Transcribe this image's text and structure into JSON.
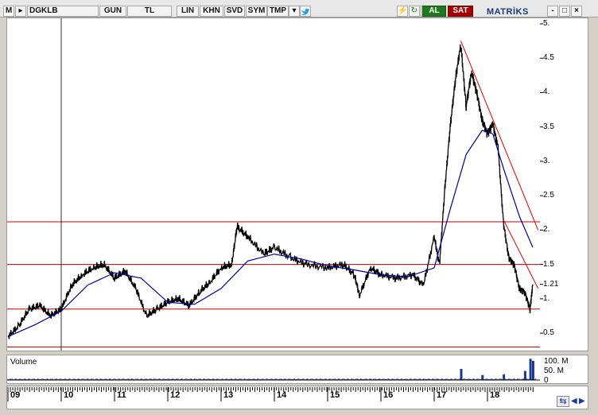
{
  "toolbar": {
    "window_icon": "M",
    "symbol": "DGKLB",
    "period": "GUN",
    "currency": "TL",
    "scale_lin": "LIN",
    "khn": "KHN",
    "svd": "SVD",
    "sym": "SYM",
    "tmp": "TMP",
    "buy": "AL",
    "sell": "SAT",
    "brand": "MATRİKS",
    "minimize": "-",
    "restore": "□",
    "close": "×",
    "icons": [
      "dropdown-arrow-icon",
      "twitter-bird-icon",
      "lightning-icon",
      "refresh-icon",
      "settings-icon"
    ]
  },
  "colors": {
    "candles": "#000000",
    "moving_average": "#0000a0",
    "horizontal_levels": "#c00000",
    "trend_lines": "#e00000",
    "volume": "#1a3a8a",
    "buy_bg": "#1f7a1f",
    "sell_bg": "#a80000",
    "brand": "#1a3a7a"
  },
  "chart_data": {
    "type": "line",
    "x_ticks": [
      "09",
      "10",
      "11",
      "12",
      "13",
      "14",
      "15",
      "16",
      "17",
      "18"
    ],
    "y_ticks": [
      "5.",
      "4.5",
      "4.",
      "3.5",
      "3.",
      "2.5",
      "2.",
      "1.5",
      "1.21",
      "1.",
      "0.5"
    ],
    "ylim": [
      0.2,
      5.0
    ],
    "last_price": "1.21",
    "horizontal_levels": [
      0.3,
      0.85,
      1.5,
      2.12
    ],
    "vertical_marker_year": "10",
    "price_series": [
      {
        "x": 2009.0,
        "y": 0.45
      },
      {
        "x": 2009.2,
        "y": 0.6
      },
      {
        "x": 2009.4,
        "y": 0.85
      },
      {
        "x": 2009.6,
        "y": 0.9
      },
      {
        "x": 2009.8,
        "y": 0.75
      },
      {
        "x": 2010.0,
        "y": 0.85
      },
      {
        "x": 2010.2,
        "y": 1.2
      },
      {
        "x": 2010.4,
        "y": 1.35
      },
      {
        "x": 2010.6,
        "y": 1.45
      },
      {
        "x": 2010.8,
        "y": 1.5
      },
      {
        "x": 2011.0,
        "y": 1.3
      },
      {
        "x": 2011.2,
        "y": 1.4
      },
      {
        "x": 2011.4,
        "y": 1.15
      },
      {
        "x": 2011.6,
        "y": 0.75
      },
      {
        "x": 2011.8,
        "y": 0.85
      },
      {
        "x": 2012.0,
        "y": 0.95
      },
      {
        "x": 2012.2,
        "y": 1.0
      },
      {
        "x": 2012.4,
        "y": 0.9
      },
      {
        "x": 2012.6,
        "y": 1.1
      },
      {
        "x": 2012.8,
        "y": 1.25
      },
      {
        "x": 2013.0,
        "y": 1.45
      },
      {
        "x": 2013.2,
        "y": 1.5
      },
      {
        "x": 2013.3,
        "y": 2.05
      },
      {
        "x": 2013.5,
        "y": 1.9
      },
      {
        "x": 2013.8,
        "y": 1.65
      },
      {
        "x": 2014.0,
        "y": 1.75
      },
      {
        "x": 2014.3,
        "y": 1.6
      },
      {
        "x": 2014.6,
        "y": 1.5
      },
      {
        "x": 2015.0,
        "y": 1.45
      },
      {
        "x": 2015.3,
        "y": 1.5
      },
      {
        "x": 2015.5,
        "y": 1.35
      },
      {
        "x": 2015.6,
        "y": 1.05
      },
      {
        "x": 2015.8,
        "y": 1.45
      },
      {
        "x": 2016.0,
        "y": 1.35
      },
      {
        "x": 2016.3,
        "y": 1.3
      },
      {
        "x": 2016.6,
        "y": 1.35
      },
      {
        "x": 2016.8,
        "y": 1.2
      },
      {
        "x": 2017.0,
        "y": 1.9
      },
      {
        "x": 2017.1,
        "y": 1.5
      },
      {
        "x": 2017.2,
        "y": 2.6
      },
      {
        "x": 2017.3,
        "y": 3.5
      },
      {
        "x": 2017.4,
        "y": 4.2
      },
      {
        "x": 2017.5,
        "y": 4.7
      },
      {
        "x": 2017.6,
        "y": 3.8
      },
      {
        "x": 2017.7,
        "y": 4.3
      },
      {
        "x": 2017.8,
        "y": 4.0
      },
      {
        "x": 2017.9,
        "y": 3.6
      },
      {
        "x": 2018.0,
        "y": 3.4
      },
      {
        "x": 2018.1,
        "y": 3.55
      },
      {
        "x": 2018.2,
        "y": 3.2
      },
      {
        "x": 2018.3,
        "y": 2.1
      },
      {
        "x": 2018.4,
        "y": 1.6
      },
      {
        "x": 2018.5,
        "y": 1.5
      },
      {
        "x": 2018.6,
        "y": 1.15
      },
      {
        "x": 2018.7,
        "y": 1.1
      },
      {
        "x": 2018.8,
        "y": 0.85
      },
      {
        "x": 2018.85,
        "y": 1.21
      }
    ],
    "moving_average": [
      {
        "x": 2009.0,
        "y": 0.45
      },
      {
        "x": 2009.5,
        "y": 0.62
      },
      {
        "x": 2010.0,
        "y": 0.82
      },
      {
        "x": 2010.5,
        "y": 1.2
      },
      {
        "x": 2011.0,
        "y": 1.38
      },
      {
        "x": 2011.5,
        "y": 1.3
      },
      {
        "x": 2012.0,
        "y": 0.95
      },
      {
        "x": 2012.5,
        "y": 0.92
      },
      {
        "x": 2013.0,
        "y": 1.15
      },
      {
        "x": 2013.5,
        "y": 1.55
      },
      {
        "x": 2014.0,
        "y": 1.65
      },
      {
        "x": 2014.5,
        "y": 1.58
      },
      {
        "x": 2015.0,
        "y": 1.48
      },
      {
        "x": 2015.5,
        "y": 1.42
      },
      {
        "x": 2016.0,
        "y": 1.35
      },
      {
        "x": 2016.5,
        "y": 1.32
      },
      {
        "x": 2017.0,
        "y": 1.45
      },
      {
        "x": 2017.3,
        "y": 2.3
      },
      {
        "x": 2017.6,
        "y": 3.1
      },
      {
        "x": 2017.9,
        "y": 3.45
      },
      {
        "x": 2018.1,
        "y": 3.4
      },
      {
        "x": 2018.3,
        "y": 2.9
      },
      {
        "x": 2018.6,
        "y": 2.2
      },
      {
        "x": 2018.85,
        "y": 1.75
      }
    ],
    "trend_lines": [
      {
        "x1": 2017.5,
        "y1": 4.75,
        "x2": 2018.95,
        "y2": 2.0
      },
      {
        "x1": 2018.3,
        "y1": 2.15,
        "x2": 2018.95,
        "y2": 1.15
      }
    ]
  },
  "volume_panel": {
    "label": "Volume",
    "ticks": [
      "100. M",
      "50. M",
      "0"
    ],
    "spikes": [
      {
        "x": 2017.5,
        "v": 55
      },
      {
        "x": 2017.9,
        "v": 25
      },
      {
        "x": 2018.3,
        "v": 28
      },
      {
        "x": 2018.7,
        "v": 45
      },
      {
        "x": 2018.8,
        "v": 105
      },
      {
        "x": 2018.85,
        "v": 95
      }
    ]
  }
}
